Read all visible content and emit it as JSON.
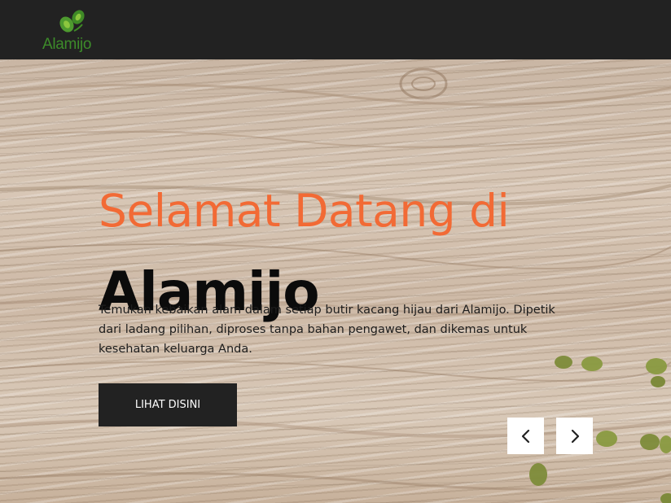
{
  "header": {
    "logo_text": "Alamijo"
  },
  "hero": {
    "welcome": "Selamat Datang di",
    "brand": "Alamijo",
    "description": "Temukan kebaikan alam dalam setiap butir kacang hijau dari Alamijo. Dipetik dari ladang pilihan, diproses tanpa bahan pengawet, dan dikemas untuk kesehatan keluarga Anda.",
    "cta_label": "LIHAT DISINI"
  },
  "carousel": {
    "prev_icon": "chevron-left-icon",
    "next_icon": "chevron-right-icon"
  },
  "colors": {
    "accent": "#f26a35",
    "header_bg": "#222222",
    "logo_green": "#3d8b2a",
    "button_bg": "#222222"
  }
}
